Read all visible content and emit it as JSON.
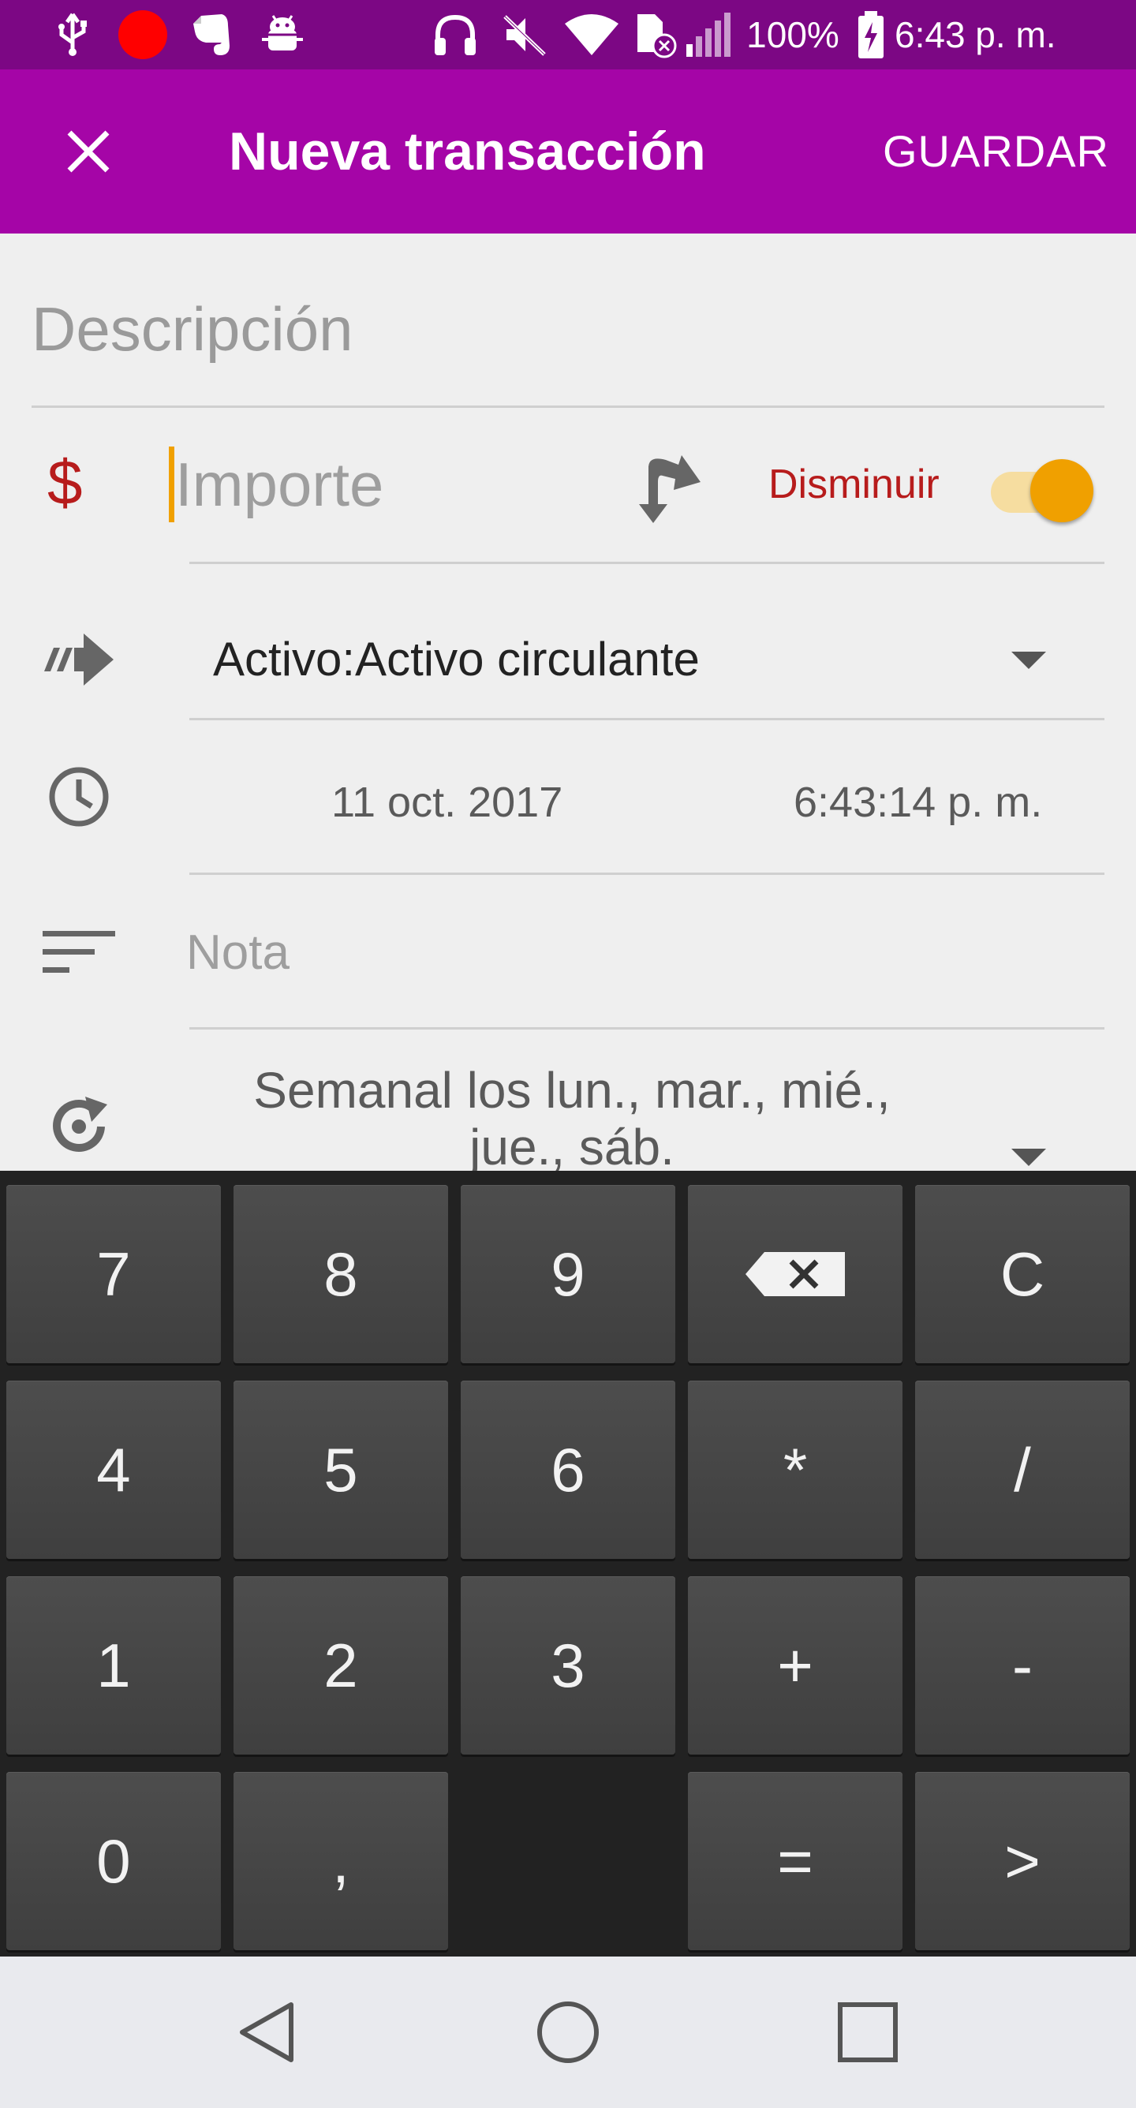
{
  "status_bar": {
    "battery": "100%",
    "time": "6:43 p. m.",
    "icons": [
      "usb-icon",
      "record-icon",
      "evernote-icon",
      "android-debug-icon",
      "headphones-icon",
      "mute-icon",
      "wifi-icon",
      "no-sim-icon",
      "signal-icon",
      "battery-charging-icon"
    ]
  },
  "app_bar": {
    "close_icon": "close-icon",
    "title": "Nueva transacción",
    "save_label": "GUARDAR"
  },
  "form": {
    "description_placeholder": "Descripción",
    "currency_symbol": "$",
    "amount_placeholder": "Importe",
    "direction_label": "Disminuir",
    "direction_toggle_on": true,
    "account": "Activo:Activo circulante",
    "date": "11 oct. 2017",
    "time": "6:43:14 p. m.",
    "note_placeholder": "Nota",
    "recurrence_line1": "Semanal los lun., mar., mié.,",
    "recurrence_line2": "jue., sáb."
  },
  "keypad": {
    "rows": [
      [
        "7",
        "8",
        "9",
        "backspace",
        "C"
      ],
      [
        "4",
        "5",
        "6",
        "*",
        "/"
      ],
      [
        "1",
        "2",
        "3",
        "+",
        "-"
      ],
      [
        "0",
        ",",
        "",
        "=",
        ">"
      ]
    ],
    "labels": {
      "k7": "7",
      "k8": "8",
      "k9": "9",
      "kC": "C",
      "k4": "4",
      "k5": "5",
      "k6": "6",
      "kmul": "*",
      "kdiv": "/",
      "k1": "1",
      "k2": "2",
      "k3": "3",
      "kplus": "+",
      "kminus": "-",
      "k0": "0",
      "kcomma": ",",
      "keq": "=",
      "knext": ">"
    }
  },
  "colors": {
    "status_bar": "#7c0784",
    "app_bar": "#a505a7",
    "accent": "#f0a000",
    "negative": "#b71c1c",
    "keypad_bg": "#222222",
    "key_bg": "#474747"
  }
}
